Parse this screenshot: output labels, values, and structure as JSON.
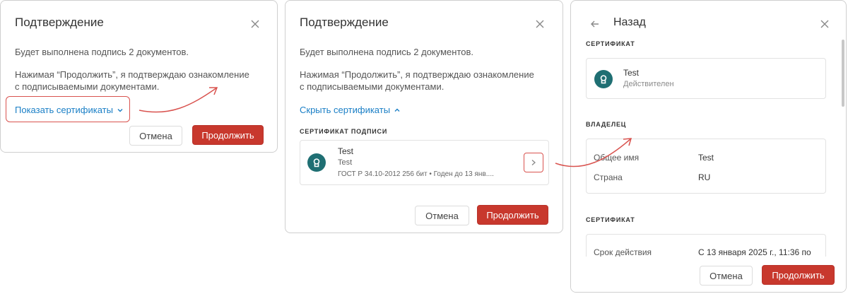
{
  "dialog1": {
    "title": "Подтверждение",
    "line1": "Будет выполнена подпись 2 документов.",
    "line2a": "Нажимая “Продолжить”, я подтверждаю ознакомление",
    "line2b": "с подписываемыми документами.",
    "show_certs": "Показать сертификаты",
    "cancel": "Отмена",
    "continue": "Продолжить"
  },
  "dialog2": {
    "title": "Подтверждение",
    "line1": "Будет выполнена подпись 2 документов.",
    "line2a": "Нажимая “Продолжить”, я подтверждаю ознакомление",
    "line2b": "с подписываемыми документами.",
    "hide_certs": "Скрыть сертификаты",
    "section": "СЕРТИФИКАТ ПОДПИСИ",
    "cert": {
      "name": "Test",
      "sub": "Test",
      "meta": "ГОСТ Р 34.10-2012 256 бит • Годен до 13 янв...."
    },
    "cancel": "Отмена",
    "continue": "Продолжить"
  },
  "dialog3": {
    "back": "Назад",
    "section_cert": "СЕРТИФИКАТ",
    "cert_name": "Test",
    "cert_status": "Действителен",
    "section_owner": "ВЛАДЕЛЕЦ",
    "owner": [
      {
        "label": "Общее имя",
        "value": "Test"
      },
      {
        "label": "Страна",
        "value": "RU"
      }
    ],
    "section_cert2": "СЕРТИФИКАТ",
    "validity_label": "Срок действия",
    "validity_value": "С 13 января 2025 г., 11:36 по",
    "cancel": "Отмена",
    "continue": "Продолжить"
  },
  "colors": {
    "accent": "#c8382d",
    "link": "#1a7fc6",
    "avatar": "#1f6f73",
    "highlight": "#d9534f"
  }
}
